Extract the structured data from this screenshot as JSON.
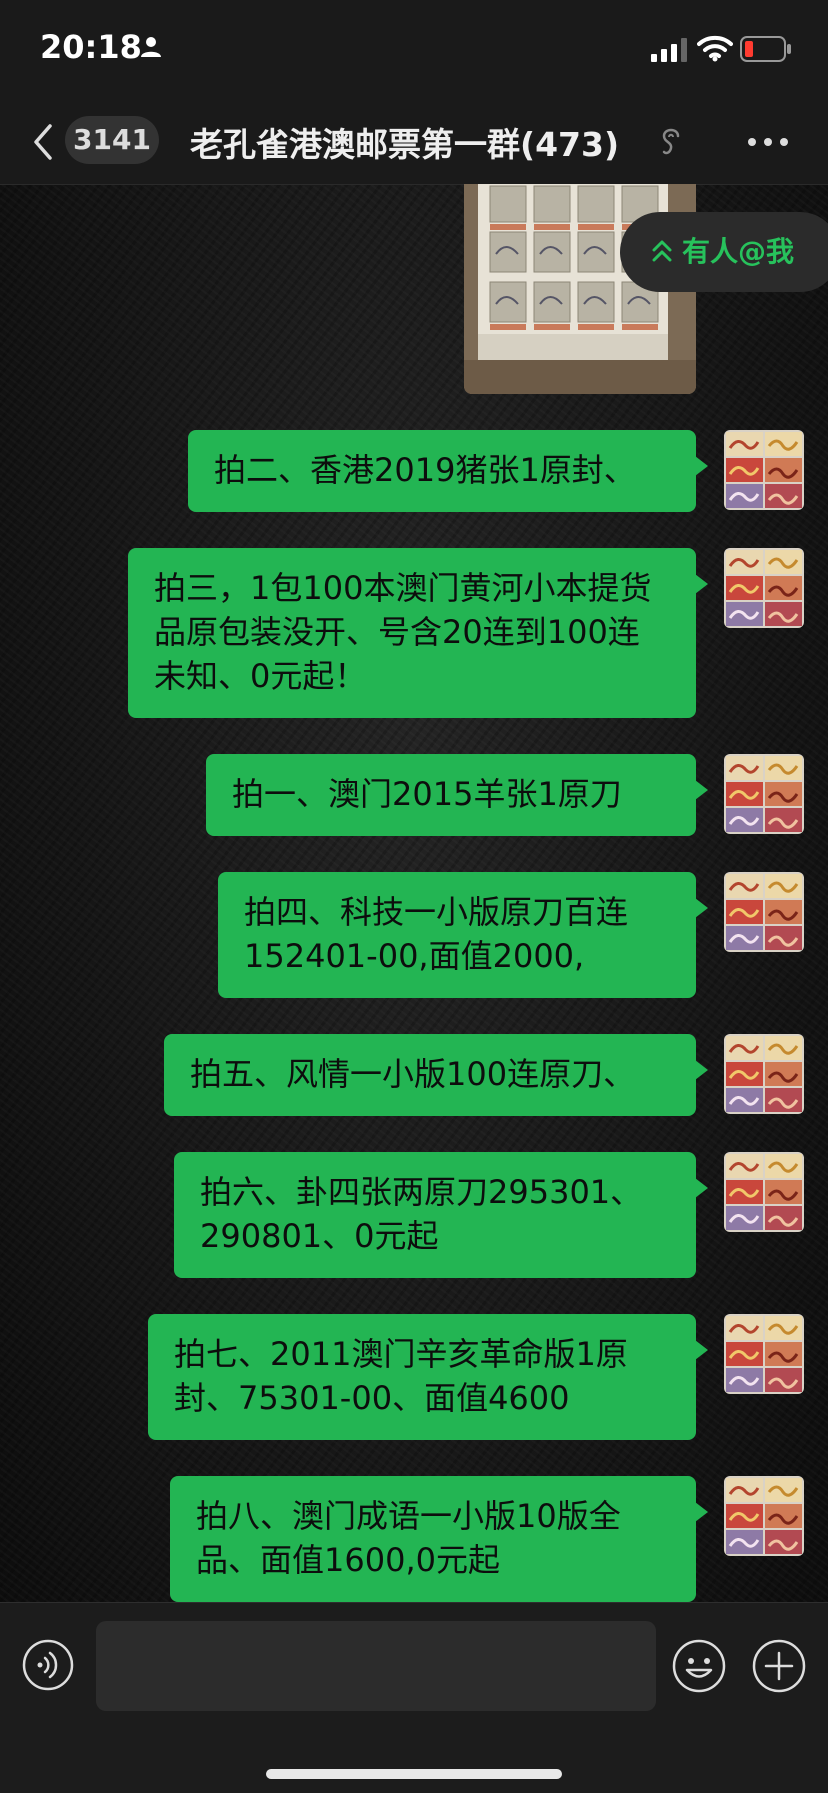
{
  "status": {
    "time": "20:18"
  },
  "nav": {
    "unread_count": "3141",
    "title": "老孔雀港澳邮票第一群(473)"
  },
  "mention": {
    "label": "有人@我"
  },
  "messages": [
    {
      "text": "拍二、香港2019猪张1原封、"
    },
    {
      "text": "拍三，1包100本澳门黄河小本提货品原包装没开、号含20连到100连未知、0元起！"
    },
    {
      "text": "拍一、澳门2015羊张1原刀"
    },
    {
      "text": "拍四、科技一小版原刀百连152401-00,面值2000,"
    },
    {
      "text": "拍五、风情一小版100连原刀、"
    },
    {
      "text": "拍六、卦四张两原刀295301、290801、0元起"
    },
    {
      "text": "拍七、2011澳门辛亥革命版1原封、75301-00、面值4600"
    },
    {
      "text": "拍八、澳门成语一小版10版全品、面值1600,0元起"
    }
  ],
  "colors": {
    "bubble": "#23b553",
    "accent": "#27c25c",
    "background": "#121212"
  },
  "icons": [
    "person-icon",
    "signal-icon",
    "wifi-icon",
    "battery-icon",
    "back-icon",
    "mute-icon",
    "more-icon",
    "chevrons-up-icon",
    "voice-icon",
    "emoji-icon",
    "plus-icon"
  ]
}
